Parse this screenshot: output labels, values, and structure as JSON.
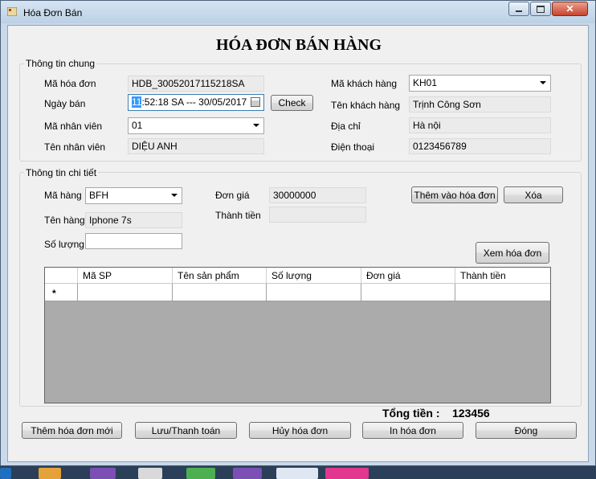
{
  "window": {
    "title": "Hóa Đơn Bán"
  },
  "heading": "HÓA ĐƠN BÁN HÀNG",
  "general": {
    "group_label": "Thông tin chung",
    "invoice_id_label": "Mã hóa đơn",
    "invoice_id": "HDB_30052017115218SA",
    "sale_date_label": "Ngày bán",
    "sale_date_hour": "11",
    "sale_date_rest": ":52:18 SA --- 30/05/2017",
    "check_button": "Check",
    "employee_id_label": "Mã nhân viên",
    "employee_id": "01",
    "employee_name_label": "Tên nhân viên",
    "employee_name": "DIỆU ANH",
    "customer_id_label": "Mã khách hàng",
    "customer_id": "KH01",
    "customer_name_label": "Tên khách hàng",
    "customer_name": "Trịnh Công Sơn",
    "address_label": "Địa chỉ",
    "address": "Hà nội",
    "phone_label": "Điện thoại",
    "phone": "0123456789"
  },
  "detail": {
    "group_label": "Thông tin chi tiết",
    "product_id_label": "Mã hàng",
    "product_id": "BFH",
    "product_name_label": "Tên hàng",
    "product_name": "Iphone 7s",
    "quantity_label": "Số lượng",
    "quantity": "",
    "unit_price_label": "Đơn giá",
    "unit_price": "30000000",
    "amount_label": "Thành tiền",
    "amount": "",
    "add_to_invoice_button": "Thêm vào hóa đơn",
    "delete_button": "Xóa",
    "view_invoice_button": "Xem hóa đơn"
  },
  "grid": {
    "columns": [
      "Mã SP",
      "Tên sản phẩm",
      "Số lượng",
      "Đơn giá",
      "Thành tiền"
    ],
    "new_row_marker": "*"
  },
  "total": {
    "label": "Tổng tiền :",
    "value": "123456"
  },
  "actions": {
    "new_invoice": "Thêm hóa đơn mới",
    "save_pay": "Lưu/Thanh toán",
    "cancel_invoice": "Hủy hóa đơn",
    "print_invoice": "In hóa đơn",
    "close": "Đóng"
  },
  "colors": {
    "accent": "#3399ff",
    "window_frame": "#c9d9ea",
    "close_button": "#c8442e"
  }
}
